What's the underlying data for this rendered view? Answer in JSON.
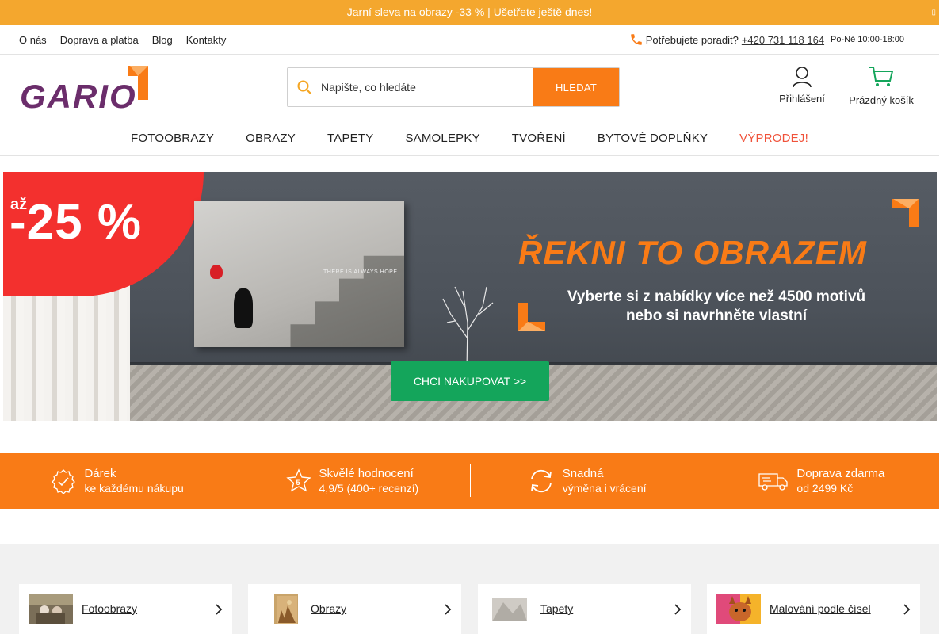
{
  "promo": {
    "text": "Jarní sleva na obrazy -33 % | Ušetřete ještě dnes!",
    "close": ""
  },
  "top_links": [
    "O nás",
    "Doprava a platba",
    "Blog",
    "Kontakty"
  ],
  "support": {
    "question": "Potřebujete poradit?",
    "phone": "+420 731 118 164",
    "hours": "Po-Ně 10:00-18:00"
  },
  "logo": {
    "text": "GARIO"
  },
  "search": {
    "placeholder": "Napište, co hledáte",
    "button": "HLEDAT"
  },
  "account": {
    "label": "Přihlášení"
  },
  "cart": {
    "label": "Prázdný košík"
  },
  "main_nav": [
    "FOTOOBRAZY",
    "OBRAZY",
    "TAPETY",
    "SAMOLEPKY",
    "TVOŘENÍ",
    "BYTOVÉ DOPLŇKY",
    "VÝPRODEJ!"
  ],
  "hero": {
    "badge_prefix": "až",
    "badge_value": "-25 %",
    "headline": "ŘEKNI TO OBRAZEM",
    "subline1": "Vyberte si z nabídky více než 4500 motivů",
    "subline2": "nebo si navrhněte vlastní",
    "cta": "CHCI NAKUPOVAT >>",
    "painting_text": "THERE IS ALWAYS HOPE"
  },
  "benefits": [
    {
      "title": "Dárek",
      "text": "ke každému nákupu",
      "icon": "gift-check-icon"
    },
    {
      "title": "Skvělé hodnocení",
      "text": "4,9/5 (400+ recenzí)",
      "icon": "star-icon"
    },
    {
      "title": "Snadná",
      "text": "výměna i vrácení",
      "icon": "refresh-icon"
    },
    {
      "title": "Doprava zdarma",
      "text": "od 2499 Kč",
      "icon": "truck-icon"
    }
  ],
  "categories": [
    {
      "label": "Fotoobrazy"
    },
    {
      "label": "Obrazy"
    },
    {
      "label": "Tapety"
    },
    {
      "label": "Malování podle čísel"
    }
  ],
  "colors": {
    "orange": "#f97b16",
    "promo": "#f4a72e",
    "green": "#14a55b",
    "red": "#f3302e",
    "purple": "#6b2d6b"
  }
}
